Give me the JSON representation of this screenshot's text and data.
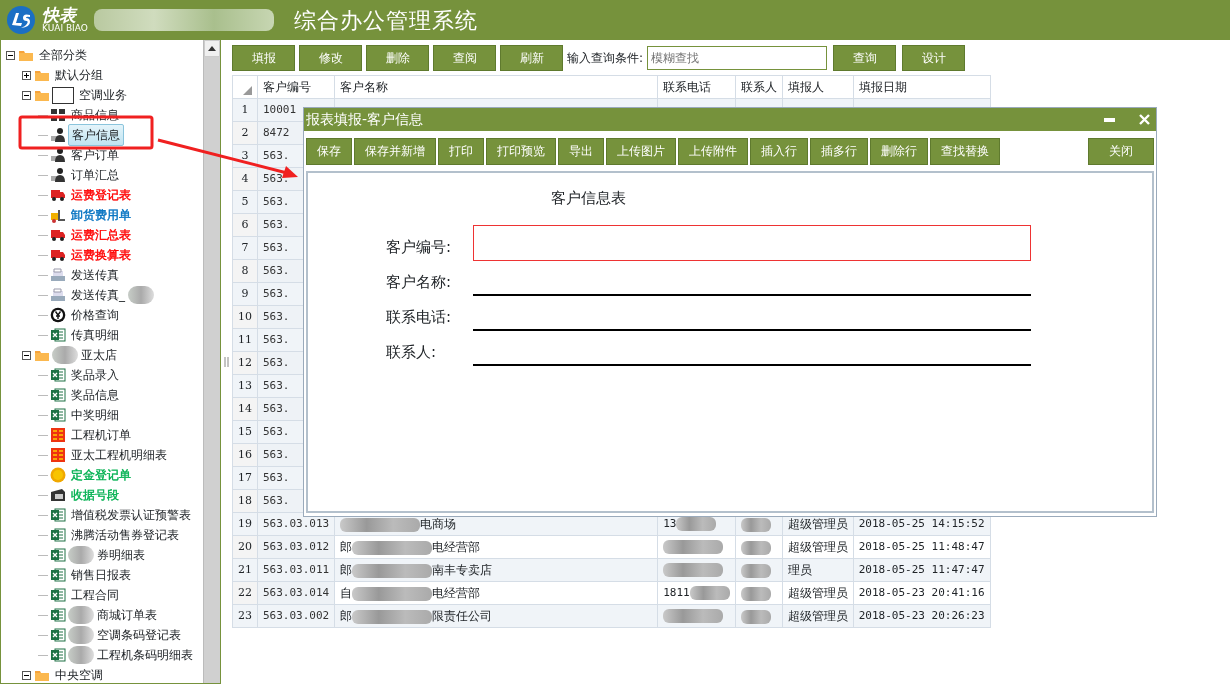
{
  "header": {
    "logo_text": "快表",
    "logo_sub": "KUAI BIAO",
    "title": "综合办公管理系统"
  },
  "tree": [
    {
      "label": "全部分类",
      "kind": "folder",
      "expanded": true,
      "children": [
        {
          "label": "默认分组",
          "kind": "folder",
          "expanded": false
        },
        {
          "label": "空调业务",
          "kind": "folder",
          "placeholder_box": true,
          "expanded": true,
          "children": [
            {
              "label": "商品信息",
              "kind": "grid",
              "selected": false
            },
            {
              "label": "客户信息",
              "kind": "person",
              "selected": true
            },
            {
              "label": "客户订单",
              "kind": "person",
              "selected": false
            },
            {
              "label": "订单汇总",
              "kind": "person",
              "selected": false
            },
            {
              "label": "运费登记表",
              "kind": "truck",
              "color": "#ff0000",
              "selected": false
            },
            {
              "label": "卸货费用单",
              "kind": "forklift",
              "color": "#0070c0",
              "selected": false
            },
            {
              "label": "运费汇总表",
              "kind": "truck",
              "color": "#ff0000",
              "selected": false
            },
            {
              "label": "运费换算表",
              "kind": "truck",
              "color": "#ff0000",
              "selected": false
            },
            {
              "label": "发送传真",
              "kind": "fax",
              "selected": false
            },
            {
              "label": "发送传真_",
              "kind": "fax",
              "redacted_after": true,
              "selected": false
            },
            {
              "label": "价格查询",
              "kind": "yen",
              "selected": false
            },
            {
              "label": "传真明细",
              "kind": "excel",
              "selected": false
            }
          ]
        },
        {
          "label": "亚太店",
          "kind": "folder",
          "redacted_before": true,
          "expanded": true,
          "children": [
            {
              "label": "奖品录入",
              "kind": "excel",
              "selected": false
            },
            {
              "label": "奖品信息",
              "kind": "excel",
              "selected": false
            },
            {
              "label": "中奖明细",
              "kind": "excel",
              "selected": false
            },
            {
              "label": "工程机订单",
              "kind": "appliance",
              "selected": false
            },
            {
              "label": "亚太工程机明细表",
              "kind": "appliance",
              "selected": false
            },
            {
              "label": "定金登记单",
              "kind": "coin",
              "color": "#00b050",
              "selected": false
            },
            {
              "label": "收据号段",
              "kind": "receipt",
              "color": "#00b050",
              "selected": false
            },
            {
              "label": "增值税发票认证预警表",
              "kind": "excel",
              "selected": false
            },
            {
              "label": "沸腾活动售券登记表",
              "kind": "excel",
              "selected": false
            },
            {
              "label": "券明细表",
              "kind": "excel",
              "redacted_before": true,
              "selected": false
            },
            {
              "label": "销售日报表",
              "kind": "excel",
              "selected": false
            },
            {
              "label": "工程合同",
              "kind": "excel",
              "selected": false
            },
            {
              "label": "商城订单表",
              "kind": "excel",
              "redacted_before": true,
              "selected": false
            },
            {
              "label": "空调条码登记表",
              "kind": "excel",
              "redacted_before": true,
              "selected": false
            },
            {
              "label": "工程机条码明细表",
              "kind": "excel",
              "redacted_before": true,
              "selected": false
            }
          ]
        },
        {
          "label": "中央空调",
          "kind": "folder",
          "expanded": true
        }
      ]
    }
  ],
  "toolbar": {
    "buttons": [
      "填报",
      "修改",
      "删除",
      "查阅",
      "刷新"
    ],
    "query_label": "输入查询条件:",
    "query_placeholder": "模糊查找",
    "buttons_after": [
      "查询",
      "设计"
    ]
  },
  "table": {
    "columns": [
      "客户编号",
      "客户名称",
      "联系电话",
      "联系人",
      "填报人",
      "填报日期"
    ],
    "rows": [
      {
        "num": "1",
        "code": "10001"
      },
      {
        "num": "2",
        "code": "8472"
      },
      {
        "num": "3",
        "code": "563."
      },
      {
        "num": "4",
        "code": "563."
      },
      {
        "num": "5",
        "code": "563."
      },
      {
        "num": "6",
        "code": "563."
      },
      {
        "num": "7",
        "code": "563."
      },
      {
        "num": "8",
        "code": "563."
      },
      {
        "num": "9",
        "code": "563."
      },
      {
        "num": "10",
        "code": "563."
      },
      {
        "num": "11",
        "code": "563."
      },
      {
        "num": "12",
        "code": "563."
      },
      {
        "num": "13",
        "code": "563."
      },
      {
        "num": "14",
        "code": "563."
      },
      {
        "num": "15",
        "code": "563."
      },
      {
        "num": "16",
        "code": "563."
      },
      {
        "num": "17",
        "code": "563."
      },
      {
        "num": "18",
        "code": "563."
      },
      {
        "num": "19",
        "code": "563.03.013",
        "name_tail": "电商场",
        "phone": "13",
        "filler": "超级管理员",
        "date": "2018-05-25 14:15:52"
      },
      {
        "num": "20",
        "code": "563.03.012",
        "name_head": "郎",
        "name_tail": "电经营部",
        "filler": "超级管理员",
        "date": "2018-05-25 11:48:47"
      },
      {
        "num": "21",
        "code": "563.03.011",
        "name_head": "郎",
        "name_tail": "南丰专卖店",
        "filler": "理员",
        "date": "2018-05-25 11:47:47"
      },
      {
        "num": "22",
        "code": "563.03.014",
        "name_head": "自",
        "name_tail": "电经营部",
        "phone": "1811",
        "filler": "超级管理员",
        "date": "2018-05-23 20:41:16"
      },
      {
        "num": "23",
        "code": "563.03.002",
        "name_head": "郎",
        "name_tail": "限责任公司",
        "filler": "超级管理员",
        "date": "2018-05-23 20:26:23"
      }
    ]
  },
  "dialog": {
    "title": "报表填报-客户信息",
    "buttons": [
      "保存",
      "保存并新增",
      "打印",
      "打印预览",
      "导出",
      "上传图片",
      "上传附件",
      "插入行",
      "插多行",
      "删除行",
      "查找替换"
    ],
    "close_button": "关闭",
    "form_title": "客户信息表",
    "fields": [
      {
        "label": "客户编号:",
        "kind": "box"
      },
      {
        "label": "客户名称:",
        "kind": "line"
      },
      {
        "label": "联系电话:",
        "kind": "line"
      },
      {
        "label": "联系人:",
        "kind": "line"
      }
    ]
  }
}
